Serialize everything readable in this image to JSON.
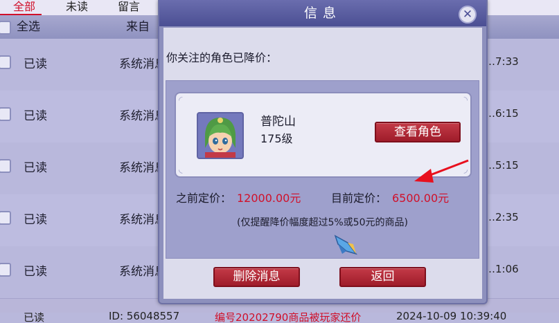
{
  "tabs": [
    {
      "label": "全部",
      "active": true
    },
    {
      "label": "未读",
      "active": false
    },
    {
      "label": "留言",
      "active": false
    }
  ],
  "header": {
    "select_all": "全选",
    "from": "来自"
  },
  "rows": [
    {
      "status": "已读",
      "from": "系统消息",
      "time": "…7:33"
    },
    {
      "status": "已读",
      "from": "系统消息",
      "time": "…6:15"
    },
    {
      "status": "已读",
      "from": "系统消息",
      "time": "…5:15"
    },
    {
      "status": "已读",
      "from": "系统消息",
      "time": "…2:35"
    },
    {
      "status": "已读",
      "from": "系统消息",
      "time": "…1:06"
    }
  ],
  "bottom_row": {
    "status": "已读",
    "from": "ID: 56048557",
    "message": "编号20202790商品被玩家还价",
    "time": "2024-10-09 10:39:40"
  },
  "dialog": {
    "title": "信息",
    "close_icon": "close-icon",
    "intro": "你关注的角色已降价：",
    "character": {
      "name": "普陀山",
      "level": "175级"
    },
    "view_button": "查看角色",
    "previous_label": "之前定价：",
    "previous_value": "12000.00元",
    "current_label": "目前定价：",
    "current_value": "6500.00元",
    "note": "(仅提醒降价幅度超过5%或50元的商品)",
    "delete_button": "删除消息",
    "back_button": "返回"
  },
  "colors": {
    "accent_red": "#d0102a",
    "arrow": "#e8101e",
    "title_bar": "#5a5da1"
  }
}
